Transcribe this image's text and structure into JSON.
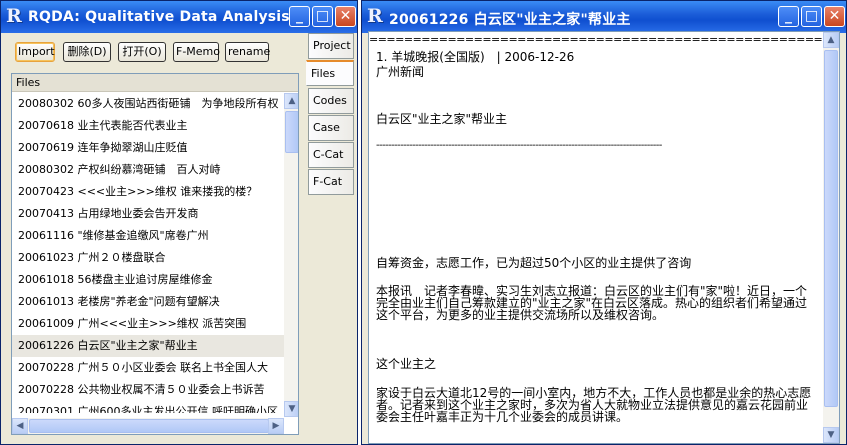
{
  "left_window": {
    "title": "RQDA: Qualitative Data Analysis.",
    "toolbar": {
      "import": "Import",
      "delete": "删除(D)",
      "open": "打开(O)",
      "fmemo": "F-Memo",
      "rename": "rename"
    },
    "files_header": "Files",
    "files": [
      "20080302 60多人夜围站西街砸铺　为争地段所有权",
      "20070618 业主代表能否代表业主",
      "20070619 连年争拗翠湖山庄贬值",
      "20080302 产权纠纷慕湾砸铺　百人对峙",
      "20070423 <<<业主>>>维权 谁来搂我的楼？",
      "20070413 占用绿地业委会告开发商",
      "20061116 \"维修基金追缴风\"席卷广州",
      "20061023 广州２０楼盘联合",
      "20061018 56楼盘主业追讨房屋维修金",
      "20061013 老楼房\"养老金\"问题有望解决",
      "20061009 广州<<<业主>>>维权 派苦突围",
      "20061226 白云区\"业主之家\"帮业主",
      "20070228 广州５０小区业委会 联名上书全国人大",
      "20070228 公共物业权属不清５０业委会上书诉苦",
      "20070301 广州600多业主发出公开信 呼吁明确小区"
    ],
    "selected_file_index": 11,
    "tabs": [
      "Project",
      "Files",
      "Codes",
      "Case",
      "C-Cat",
      "F-Cat"
    ],
    "active_tab": "Files"
  },
  "right_window": {
    "title": "20061226 白云区\"业主之家\"帮业主",
    "separator": "================================================================",
    "lines": {
      "source": "1. 羊城晚报(全国版)　| 2006-12-26",
      "section": "广州新闻",
      "headline": "白云区\"业主之家\"帮业主",
      "dashes": "-----------------------------------------------------------------------------------------------",
      "lead": "自筹资金，志愿工作，已为超过50个小区的业主提供了咨询",
      "p1": "本报讯　记者李春暐、实习生刘志立报道：白云区的业主们有\"家\"啦！近日，一个完全由业主们自己筹款建立的\"业主之家\"在白云区落成。热心的组织者们希望通过这个平台，为更多的业主提供交流场所以及维权咨询。",
      "p2": "这个业主之",
      "p3": "家设于白云大道北12号的一间小室内，地方不大，工作人员也都是业余的热心志愿者。记者来到这个业主之家时，多次为省人大就物业立法提供意见的嘉云花园前业委会主任叶嘉丰正为十几个业委会的成员讲课。"
    }
  },
  "colors": {
    "titlebar": "#1c5ed9",
    "close_button": "#c9461f",
    "tab_highlight": "#e68b2c"
  }
}
